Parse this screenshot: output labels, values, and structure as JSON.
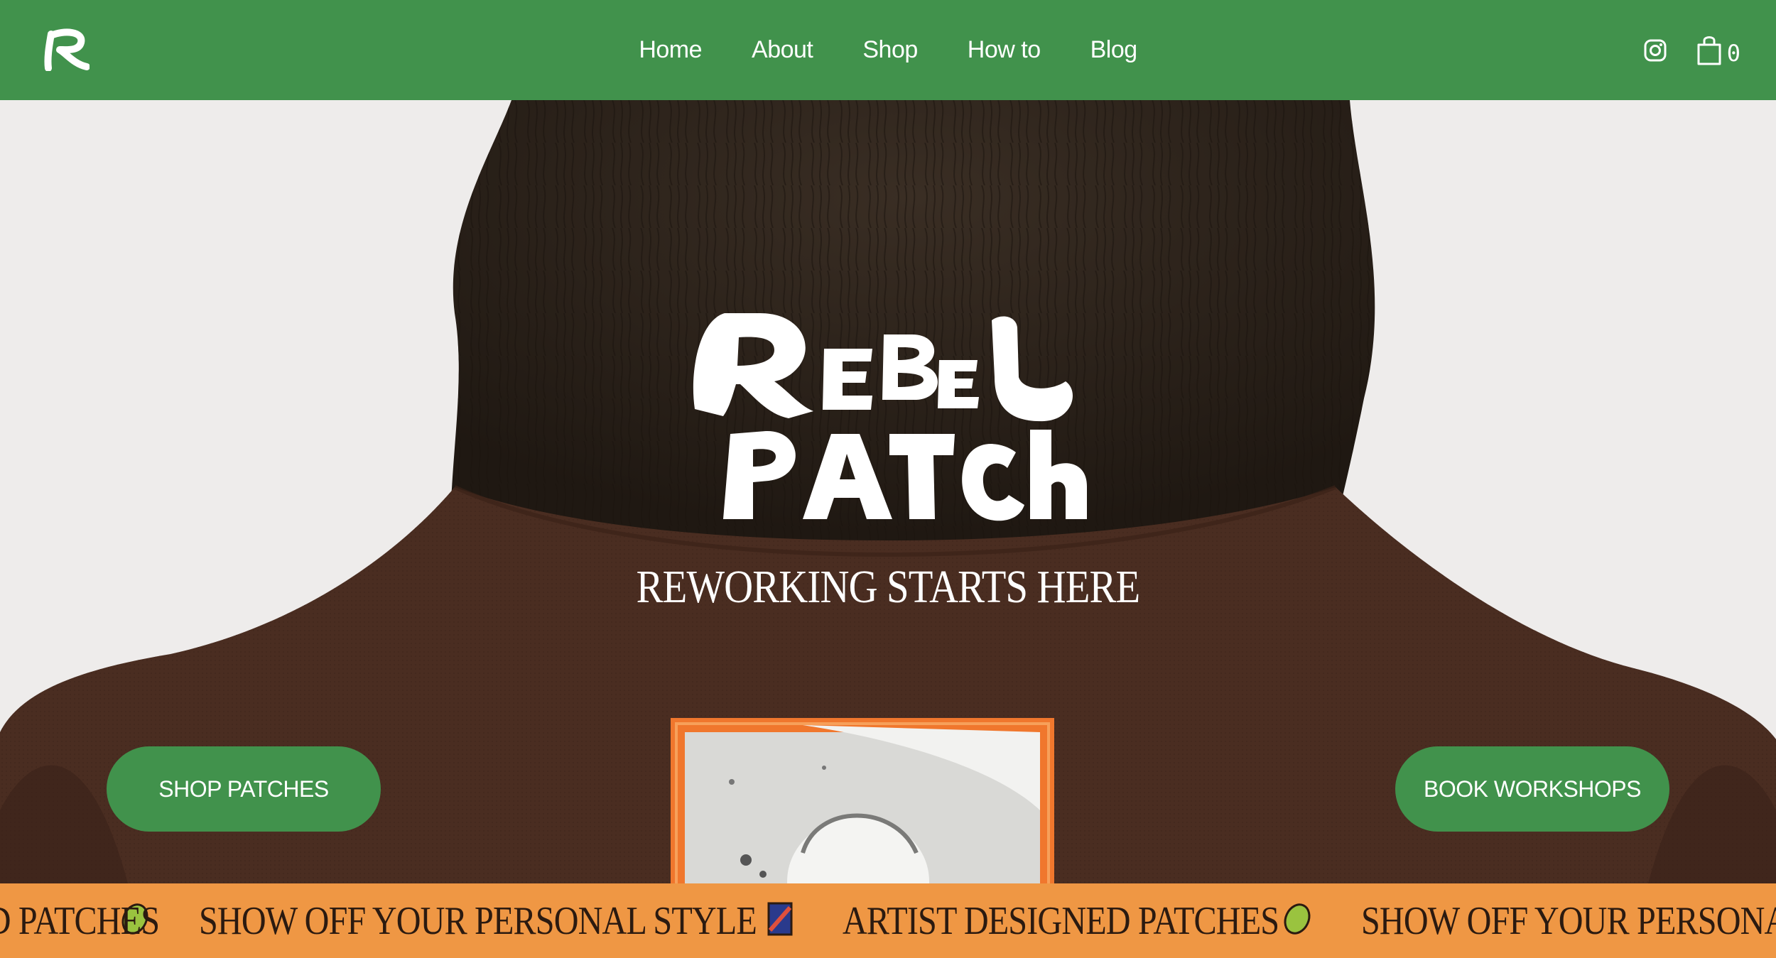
{
  "nav": {
    "logo_letter": "R",
    "links": [
      "Home",
      "About",
      "Shop",
      "How to",
      "Blog"
    ],
    "cart_count": "0",
    "icons": [
      "instagram-icon",
      "shopping-bag-icon"
    ]
  },
  "hero": {
    "brand_logo": "REBEL PATCH",
    "tagline": "REWORKING STARTS HERE",
    "shop_button": "SHOP PATCHES",
    "book_button": "BOOK WORKSHOPS"
  },
  "marquee": {
    "items": [
      "ARTIST DESIGNED PATCHES",
      "SHOW OFF YOUR PERSONAL STYLE",
      "ARTIST DESIGNED PATCHES",
      "SHOW OFF YOUR PERSONAL STYLE"
    ],
    "icons": [
      "lime-patch-icon",
      "blue-patch-icon"
    ]
  },
  "colors": {
    "brand_green": "#41924c",
    "marquee_orange": "#ef9744",
    "shirt_brown": "#4a2d21",
    "hair": "#2a2018"
  }
}
